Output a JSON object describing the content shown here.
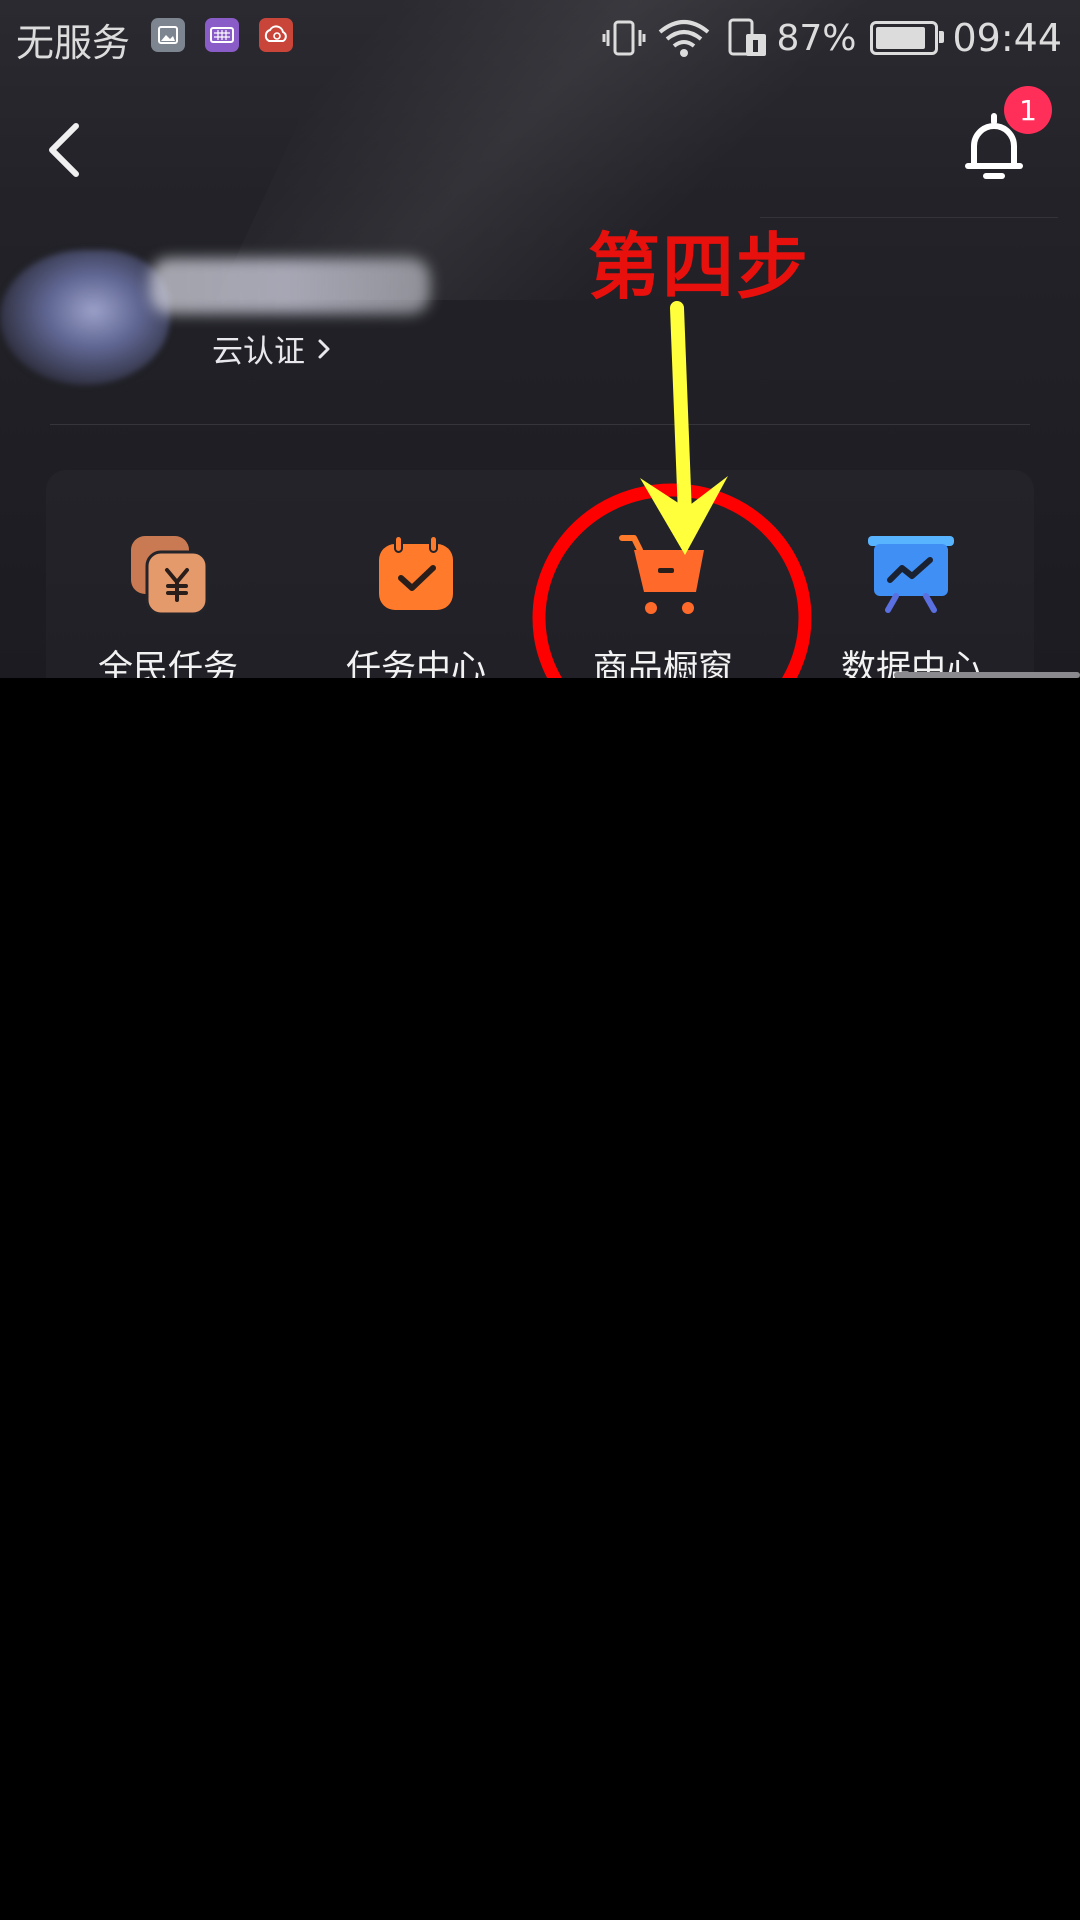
{
  "status_bar": {
    "carrier": "无服务",
    "battery_percent": "87%",
    "battery_level": 0.87,
    "time": "09:44",
    "icons": [
      "gallery-icon",
      "keyboard-icon",
      "cloud-icon",
      "vibrate-icon",
      "wifi-icon",
      "sim-icon",
      "battery-icon"
    ]
  },
  "header": {
    "notification_badge": "1",
    "icons": [
      "back-chevron-icon",
      "bell-icon"
    ]
  },
  "profile": {
    "certification_link": "云认证"
  },
  "functions": [
    {
      "label": "全民任务",
      "icon": "coin-yen-icon",
      "color": "#e08a5a"
    },
    {
      "label": "任务中心",
      "icon": "calendar-check-icon",
      "color": "#ff7a2a"
    },
    {
      "label": "商品橱窗",
      "icon": "shopping-cart-icon",
      "color": "#ff6a2a"
    },
    {
      "label": "数据中心",
      "icon": "chart-board-icon",
      "color": "#4aa6ff"
    }
  ],
  "annotation": {
    "step_text": "第四步",
    "arrow_color": "#ffff3c",
    "circle_color": "#ff0000"
  }
}
